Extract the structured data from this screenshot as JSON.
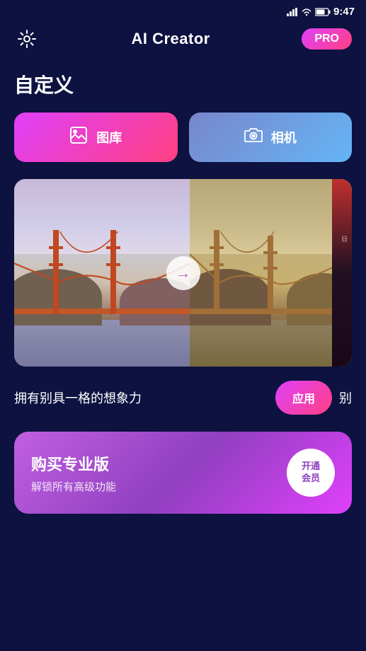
{
  "statusBar": {
    "time": "9:47"
  },
  "header": {
    "title": "AI Creator",
    "proBadge": "PRO"
  },
  "page": {
    "sectionTitle": "自定义",
    "galleryBtn": "图库",
    "cameraBtn": "相机",
    "descriptionText": "拥有别具一格的想象力",
    "applyBtn": "应用",
    "nextText": "别",
    "arrowSymbol": "→"
  },
  "proCard": {
    "title": "购买专业版",
    "subtitle": "解锁所有高级功能",
    "activateBtn": "开通\n会员"
  },
  "icons": {
    "settings": "⚙",
    "gallery": "🖼",
    "camera": "📷"
  }
}
